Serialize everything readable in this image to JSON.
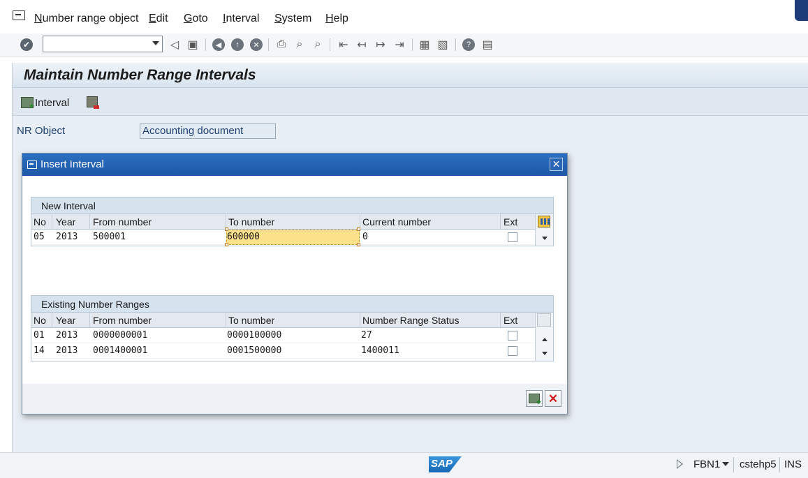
{
  "menu": {
    "items": [
      {
        "label": "Number range object",
        "u": "N",
        "rest": "umber range object"
      },
      {
        "label": "Edit",
        "u": "E",
        "rest": "dit"
      },
      {
        "label": "Goto",
        "u": "G",
        "rest": "oto"
      },
      {
        "label": "Interval",
        "u": "I",
        "rest": "nterval"
      },
      {
        "label": "System",
        "u": "S",
        "rest": "ystem"
      },
      {
        "label": "Help",
        "u": "H",
        "rest": "elp"
      }
    ]
  },
  "toolbar": {
    "command_field_value": "",
    "icons": [
      "enter-icon",
      "back-icon",
      "save-icon",
      "back-round-icon",
      "exit-round-icon",
      "cancel-round-icon",
      "print-icon",
      "find-icon",
      "find-next-icon",
      "first-page-icon",
      "previous-page-icon",
      "next-page-icon",
      "last-page-icon",
      "create-session-icon",
      "shortcut-icon",
      "help-icon",
      "layout-icon"
    ]
  },
  "screen": {
    "title": "Maintain Number Range Intervals",
    "interval_button_label": "Interval",
    "nr_object_label": "NR Object",
    "nr_object_value": "Accounting document"
  },
  "dialog": {
    "title": "Insert Interval",
    "close_label": "✕",
    "new_interval": {
      "caption": "New Interval",
      "headers": {
        "no": "No",
        "year": "Year",
        "from": "From number",
        "to": "To number",
        "current": "Current number",
        "ext": "Ext"
      },
      "rows": [
        {
          "no": "05",
          "year": "2013",
          "from": "500001",
          "to": "600000",
          "current": "0",
          "ext": false
        }
      ]
    },
    "existing": {
      "caption": "Existing Number Ranges",
      "headers": {
        "no": "No",
        "year": "Year",
        "from": "From number",
        "to": "To number",
        "status": "Number Range Status",
        "ext": "Ext"
      },
      "rows": [
        {
          "no": "01",
          "year": "2013",
          "from": "0000000001",
          "to": "0000100000",
          "status": "27",
          "ext": false
        },
        {
          "no": "14",
          "year": "2013",
          "from": "0001400001",
          "to": "0001500000",
          "status": "1400011",
          "ext": false
        }
      ]
    }
  },
  "statusbar": {
    "logo_text": "SAP",
    "transaction": "FBN1",
    "server": "cstehp5",
    "mode": "INS"
  },
  "colors": {
    "dialog_titlebar": "#1d58a6",
    "edit_highlight": "#fde18a",
    "cancel_red": "#d11d1d"
  }
}
